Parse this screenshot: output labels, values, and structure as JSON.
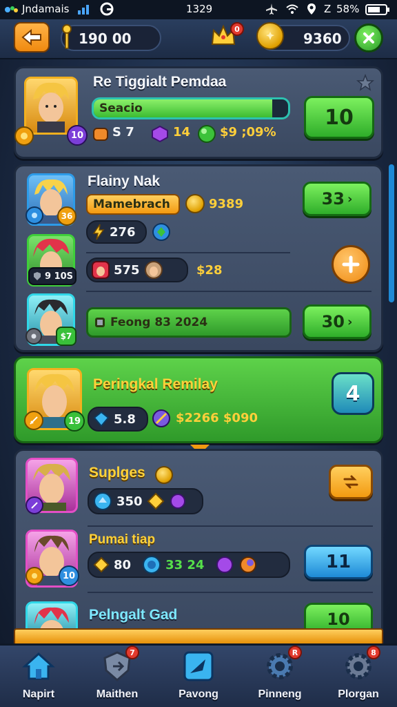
{
  "status_bar": {
    "carrier": "Jndamais",
    "time": "1329",
    "battery": "58%",
    "signal_prefix": "Z"
  },
  "top_bar": {
    "resource_value": "190 00",
    "crown_badge": "0",
    "coin_value": "9360"
  },
  "header_card": {
    "title": "Re Tiggialt Pemdaa",
    "progress_label": "Seacio",
    "progress_percent": 92,
    "level": "10",
    "stats": [
      "S 7",
      "14",
      "$9 ;09%"
    ],
    "action_value": "10"
  },
  "group_card": {
    "members": [
      {
        "name": "Flainy Nak",
        "tag": "Mamebrach",
        "coin_value": "9389",
        "level": "36",
        "stat": "276",
        "action_value": "33"
      },
      {
        "level": "9 10S",
        "stat": "575",
        "gold_value": "$28"
      },
      {
        "level": "$7",
        "progress_text": "Feong 83 2024",
        "action_value": "30"
      }
    ]
  },
  "highlight_card": {
    "title": "Peringkal Remilay",
    "level": "19",
    "stat": "5.8",
    "gold_value": "$2266 $090",
    "badge_value": "4"
  },
  "list_card": {
    "items": [
      {
        "name": "Suplges",
        "stat": "350"
      },
      {
        "name": "Pumai tiap",
        "level": "10",
        "stat_a": "80",
        "stat_b": "33 24",
        "action_value": "11"
      },
      {
        "name": "Pelngalt Gad",
        "action_value": "10"
      }
    ]
  },
  "bottom_nav": {
    "items": [
      {
        "label": "Napirt",
        "icon": "home-icon",
        "badge": ""
      },
      {
        "label": "Maithen",
        "icon": "shield-icon",
        "badge": "7"
      },
      {
        "label": "Pavong",
        "icon": "play-icon",
        "badge": ""
      },
      {
        "label": "Pinneng",
        "icon": "gear-icon",
        "badge": "R"
      },
      {
        "label": "Plorgan",
        "icon": "settings-icon",
        "badge": "8"
      }
    ]
  },
  "colors": {
    "accent_green": "#3cbc32",
    "accent_orange": "#f08a10",
    "accent_gold": "#ffd23a",
    "accent_blue": "#1e8ad6",
    "panel": "#3a4860"
  }
}
